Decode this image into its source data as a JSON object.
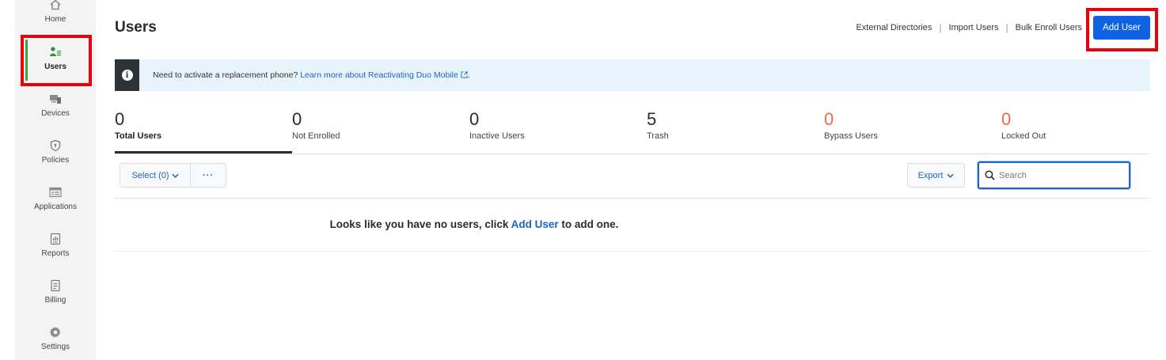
{
  "sidebar": {
    "items": [
      {
        "label": "Home",
        "icon": "home-icon"
      },
      {
        "label": "Users",
        "icon": "users-icon",
        "active": true
      },
      {
        "label": "Devices",
        "icon": "devices-icon"
      },
      {
        "label": "Policies",
        "icon": "shield-icon"
      },
      {
        "label": "Applications",
        "icon": "applications-icon"
      },
      {
        "label": "Reports",
        "icon": "reports-icon"
      },
      {
        "label": "Billing",
        "icon": "billing-icon"
      },
      {
        "label": "Settings",
        "icon": "gear-icon"
      }
    ]
  },
  "header": {
    "title": "Users",
    "links": [
      "External Directories",
      "Import Users",
      "Bulk Enroll Users"
    ],
    "add_user_label": "Add User"
  },
  "banner": {
    "text": "Need to activate a replacement phone?",
    "link_text": "Learn more about Reactivating Duo Mobile",
    "suffix": "."
  },
  "stats": [
    {
      "value": "0",
      "label": "Total Users",
      "active": true
    },
    {
      "value": "0",
      "label": "Not Enrolled"
    },
    {
      "value": "0",
      "label": "Inactive Users"
    },
    {
      "value": "5",
      "label": "Trash"
    },
    {
      "value": "0",
      "label": "Bypass Users",
      "alert": true
    },
    {
      "value": "0",
      "label": "Locked Out",
      "alert": true
    }
  ],
  "toolbar": {
    "select_label": "Select (0)",
    "more_label": "···",
    "export_label": "Export",
    "search_placeholder": "Search"
  },
  "empty_state": {
    "before": "Looks like you have no users, click ",
    "link": "Add User",
    "after": " to add one."
  },
  "colors": {
    "accent": "#0f62e1",
    "link": "#1b63c6",
    "alert": "#e8694a",
    "highlight": "#e8000b",
    "active_nav": "#3fa33f"
  }
}
